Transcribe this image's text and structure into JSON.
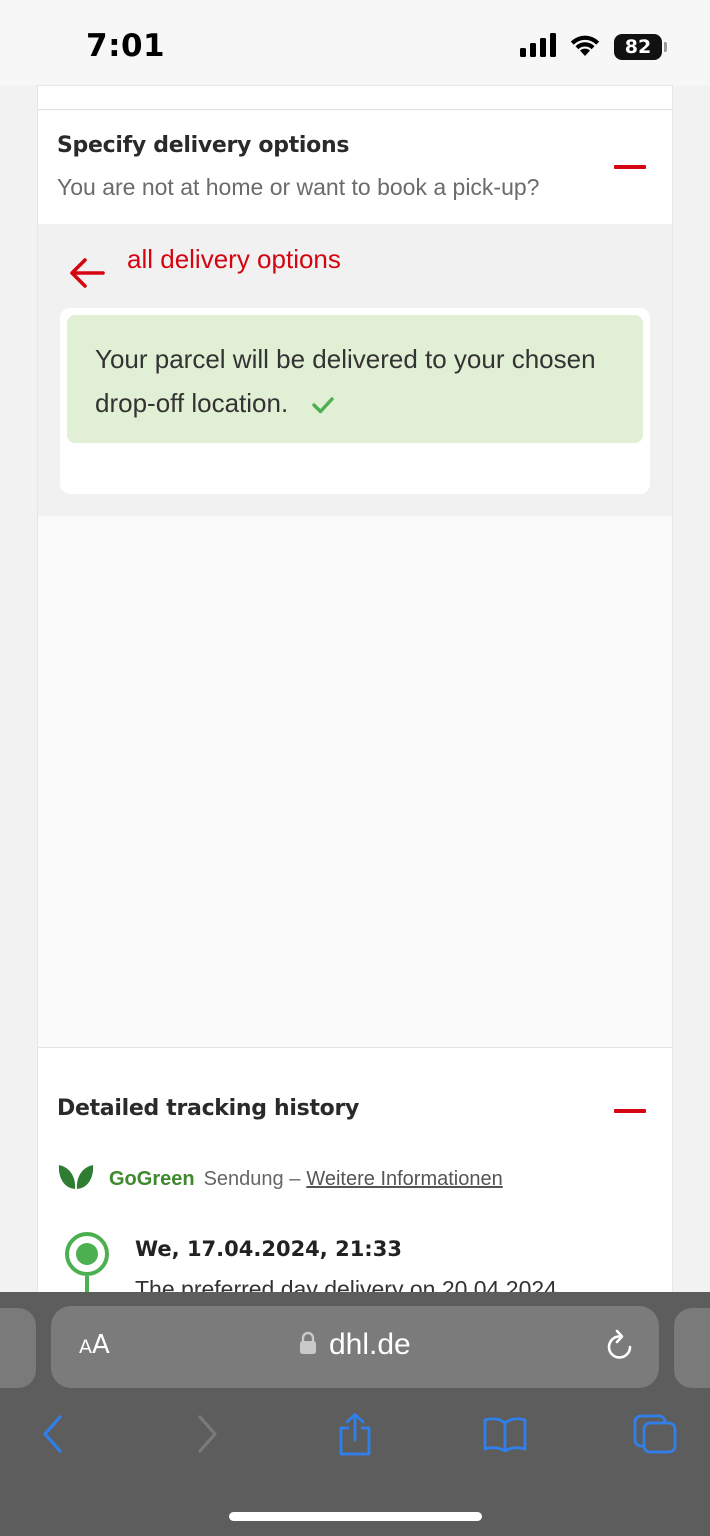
{
  "status_bar": {
    "time": "7:01",
    "battery": "82"
  },
  "delivery_options": {
    "title": "Specify delivery options",
    "subtitle": "You are not at home or want to book a pick-up?",
    "back_label": "all delivery options",
    "success_message": "Your parcel will be delivered to your chosen drop-off location."
  },
  "tracking": {
    "title": "Detailed tracking history",
    "gogreen_brand": "GoGreen",
    "gogreen_text": "Sendung –",
    "gogreen_link": "Weitere Informationen",
    "event_date": "We, 17.04.2024, 21:33",
    "event_desc": "The preferred day delivery on 20.04.2024"
  },
  "browser": {
    "aa_small": "A",
    "aa_large": "A",
    "url": "dhl.de"
  },
  "colors": {
    "accent_red": "#d40511",
    "success_bg": "#e1efd5",
    "success_green": "#4caf50",
    "gogreen": "#3f8a2f",
    "ios_blue": "#2f80ed"
  },
  "icons": {
    "back": "arrow-left-icon",
    "check": "checkmark-icon",
    "leaf": "leaf-icon",
    "lock": "lock-icon",
    "reload": "reload-icon",
    "share": "share-icon",
    "bookmarks": "book-icon",
    "tabs": "tabs-icon"
  }
}
